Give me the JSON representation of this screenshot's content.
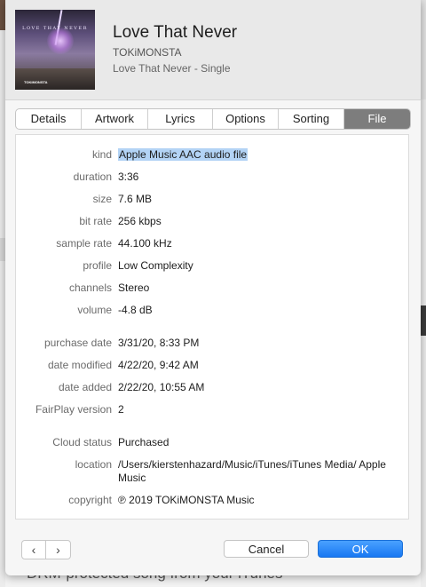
{
  "song": {
    "title": "Love That Never",
    "artist": "TOKiMONSTA",
    "album": "Love That Never - Single",
    "artwork_text": "LOVE THAT NEVER",
    "artwork_label": "TOKiMONSTA"
  },
  "tabs": [
    {
      "label": "Details"
    },
    {
      "label": "Artwork"
    },
    {
      "label": "Lyrics"
    },
    {
      "label": "Options"
    },
    {
      "label": "Sorting"
    },
    {
      "label": "File",
      "active": true
    }
  ],
  "file_info": {
    "kind": {
      "label": "kind",
      "value": "Apple Music AAC audio file"
    },
    "duration": {
      "label": "duration",
      "value": "3:36"
    },
    "size": {
      "label": "size",
      "value": "7.6 MB"
    },
    "bit_rate": {
      "label": "bit rate",
      "value": "256 kbps"
    },
    "sample_rate": {
      "label": "sample rate",
      "value": "44.100 kHz"
    },
    "profile": {
      "label": "profile",
      "value": "Low Complexity"
    },
    "channels": {
      "label": "channels",
      "value": "Stereo"
    },
    "volume": {
      "label": "volume",
      "value": "-4.8 dB"
    },
    "purchase_date": {
      "label": "purchase date",
      "value": "3/31/20, 8:33 PM"
    },
    "date_modified": {
      "label": "date modified",
      "value": "4/22/20, 9:42 AM"
    },
    "date_added": {
      "label": "date added",
      "value": "2/22/20, 10:55 AM"
    },
    "fairplay_version": {
      "label": "FairPlay version",
      "value": "2"
    },
    "cloud_status": {
      "label": "Cloud status",
      "value": "Purchased"
    },
    "location": {
      "label": "location",
      "value": "/Users/kierstenhazard/Music/iTunes/iTunes Media/ Apple Music"
    },
    "copyright": {
      "label": "copyright",
      "value": "℗ 2019 TOKiMONSTA Music"
    }
  },
  "buttons": {
    "prev": "‹",
    "next": "›",
    "cancel": "Cancel",
    "ok": "OK"
  },
  "background": {
    "bottom_text": "DRM-protected song from your iTunes"
  },
  "colors": {
    "accent": "#1878f2",
    "selection": "#b3d3f5",
    "active_tab": "#7d7d7d"
  }
}
